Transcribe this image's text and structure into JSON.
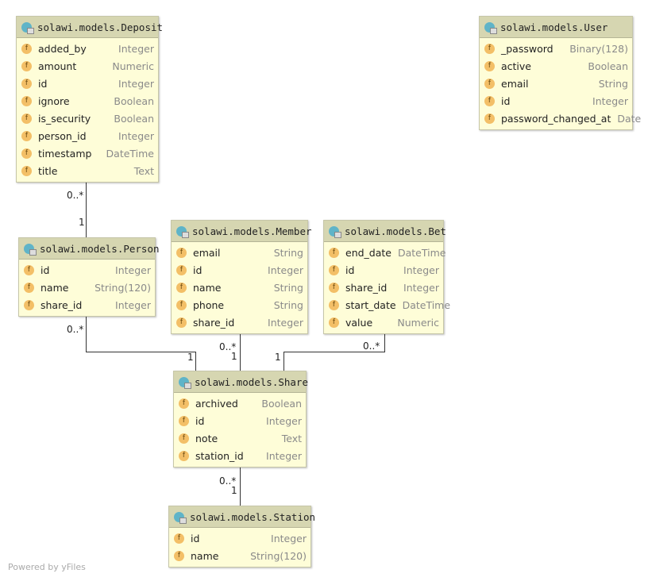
{
  "entities": [
    {
      "name": "solawi.models.Deposit",
      "fields": [
        [
          "added_by",
          "Integer"
        ],
        [
          "amount",
          "Numeric"
        ],
        [
          "id",
          "Integer"
        ],
        [
          "ignore",
          "Boolean"
        ],
        [
          "is_security",
          "Boolean"
        ],
        [
          "person_id",
          "Integer"
        ],
        [
          "timestamp",
          "DateTime"
        ],
        [
          "title",
          "Text"
        ]
      ]
    },
    {
      "name": "solawi.models.User",
      "fields": [
        [
          "_password",
          "Binary(128)"
        ],
        [
          "active",
          "Boolean"
        ],
        [
          "email",
          "String"
        ],
        [
          "id",
          "Integer"
        ],
        [
          "password_changed_at",
          "Date"
        ]
      ]
    },
    {
      "name": "solawi.models.Person",
      "fields": [
        [
          "id",
          "Integer"
        ],
        [
          "name",
          "String(120)"
        ],
        [
          "share_id",
          "Integer"
        ]
      ]
    },
    {
      "name": "solawi.models.Member",
      "fields": [
        [
          "email",
          "String"
        ],
        [
          "id",
          "Integer"
        ],
        [
          "name",
          "String"
        ],
        [
          "phone",
          "String"
        ],
        [
          "share_id",
          "Integer"
        ]
      ]
    },
    {
      "name": "solawi.models.Bet",
      "fields": [
        [
          "end_date",
          "DateTime"
        ],
        [
          "id",
          "Integer"
        ],
        [
          "share_id",
          "Integer"
        ],
        [
          "start_date",
          "DateTime"
        ],
        [
          "value",
          "Numeric"
        ]
      ]
    },
    {
      "name": "solawi.models.Share",
      "fields": [
        [
          "archived",
          "Boolean"
        ],
        [
          "id",
          "Integer"
        ],
        [
          "note",
          "Text"
        ],
        [
          "station_id",
          "Integer"
        ]
      ]
    },
    {
      "name": "solawi.models.Station",
      "fields": [
        [
          "id",
          "Integer"
        ],
        [
          "name",
          "String(120)"
        ]
      ]
    }
  ],
  "field_icon": "f",
  "multiplicities": [
    "0..*",
    "1",
    "0..*",
    "1",
    "0..*",
    "1",
    "0..*",
    "1",
    "0..*",
    "1"
  ],
  "footer": "Powered by yFiles"
}
